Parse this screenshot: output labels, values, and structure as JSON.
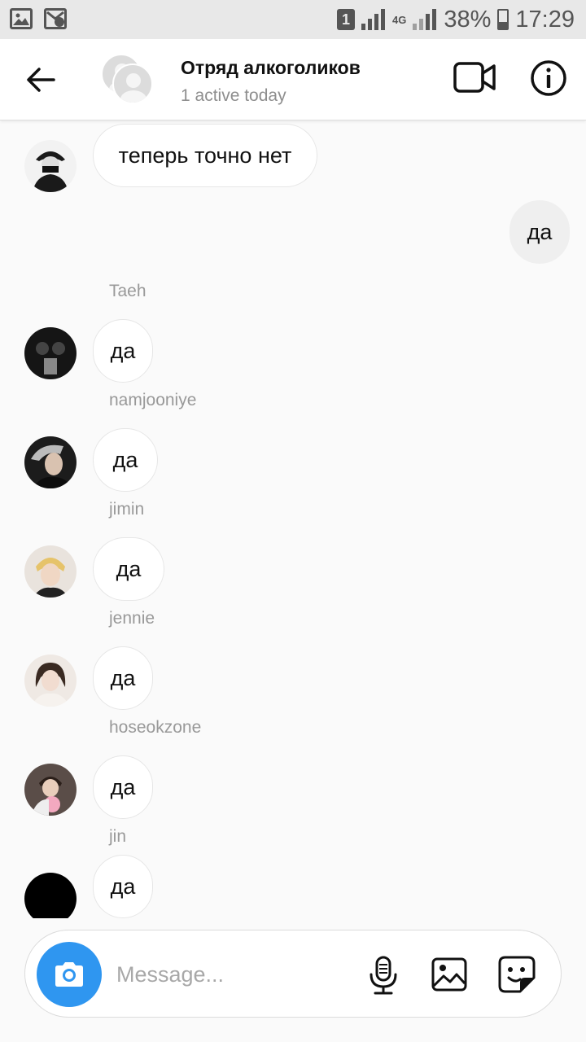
{
  "status_bar": {
    "sim_slot": "1",
    "network": "4G",
    "battery": "38%",
    "time": "17:29"
  },
  "header": {
    "title": "Отряд алкоголиков",
    "subtitle": "1 active today"
  },
  "messages": [
    {
      "text": "теперь точно нет",
      "from": "other",
      "sender": ""
    },
    {
      "text": "да",
      "from": "me",
      "sender": ""
    },
    {
      "text": "да",
      "from": "other",
      "sender": "Taeh"
    },
    {
      "text": "да",
      "from": "other",
      "sender": "namjooniye"
    },
    {
      "text": "да",
      "from": "other",
      "sender": "jimin"
    },
    {
      "text": "да",
      "from": "other",
      "sender": "jennie"
    },
    {
      "text": "да",
      "from": "other",
      "sender": "hoseokzone"
    },
    {
      "text": "да",
      "from": "other",
      "sender": "jin"
    }
  ],
  "composer": {
    "placeholder": "Message..."
  },
  "icons": {
    "back": "arrow-left-icon",
    "video": "video-camera-icon",
    "info": "info-icon",
    "camera": "camera-icon",
    "mic": "microphone-icon",
    "gallery": "image-icon",
    "sticker": "sticker-icon"
  },
  "colors": {
    "accent": "#2f96f0",
    "mine_bubble": "#efefef",
    "sender_text": "#999999"
  }
}
